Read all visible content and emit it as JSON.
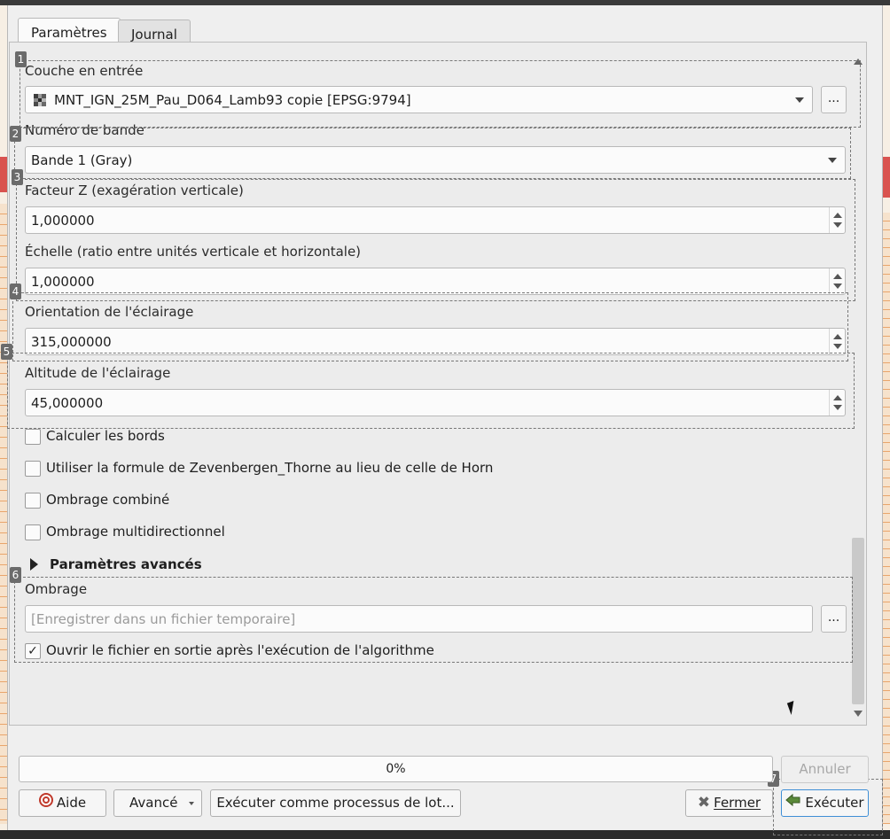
{
  "tabs": [
    {
      "label": "Paramètres"
    },
    {
      "label": "Journal"
    }
  ],
  "markers": [
    "1",
    "2",
    "3",
    "4",
    "5",
    "6",
    "7"
  ],
  "input_layer": {
    "label": "Couche en entrée",
    "value": "MNT_IGN_25M_Pau_D064_Lamb93 copie [EPSG:9794]",
    "browse_label": "..."
  },
  "band": {
    "label": "Numéro de bande",
    "value": "Bande 1 (Gray)"
  },
  "z_factor": {
    "label": "Facteur Z (exagération verticale)",
    "value": "1,000000"
  },
  "scale": {
    "label": "Échelle (ratio entre unités verticale et horizontale)",
    "value": "1,000000"
  },
  "azimuth": {
    "label": "Orientation de l'éclairage",
    "value": "315,000000"
  },
  "altitude": {
    "label": "Altitude de l'éclairage",
    "value": "45,000000"
  },
  "checkboxes": [
    {
      "label": "Calculer les bords",
      "checked": false
    },
    {
      "label": "Utiliser la formule de Zevenbergen_Thorne au lieu de celle de Horn",
      "checked": false
    },
    {
      "label": "Ombrage combiné",
      "checked": false
    },
    {
      "label": "Ombrage multidirectionnel",
      "checked": false
    }
  ],
  "advanced": {
    "label": "Paramètres avancés"
  },
  "output": {
    "label": "Ombrage",
    "placeholder": "[Enregistrer dans un fichier temporaire]",
    "browse_label": "...",
    "open_after_label": "Ouvrir le fichier en sortie après l'exécution de l'algorithme",
    "open_after_checked": true
  },
  "progress": {
    "text": "0%",
    "value": 0
  },
  "buttons": {
    "cancel": "Annuler",
    "help": "Aide",
    "advanced": "Avancé",
    "batch": "Exécuter comme processus de lot...",
    "close": "Fermer",
    "run": "Exécuter"
  },
  "colors": {
    "dialog_bg": "#efefef",
    "accent_border": "#3f8fd6",
    "marker_bg": "#6b6b6b"
  }
}
